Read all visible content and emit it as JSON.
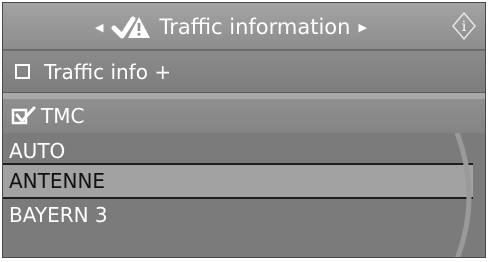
{
  "header": {
    "title": "Traffic information",
    "left_arrow_icon": "triangle-left-icon",
    "right_arrow_icon": "triangle-right-icon",
    "title_icon": "traffic-warning-icon",
    "info_button_icon": "info-icon"
  },
  "menu": {
    "traffic_info_label": "Traffic info +",
    "traffic_info_checked": false,
    "tmc_label": "TMC",
    "tmc_checked": true
  },
  "stations": [
    {
      "name": "AUTO",
      "selected": false
    },
    {
      "name": "ANTENNE",
      "selected": true
    },
    {
      "name": "BAYERN 3",
      "selected": false
    }
  ],
  "colors": {
    "panel_gray": "#7e7e7e",
    "selected_bg": "#a2a2a2",
    "text_light": "#ffffff",
    "text_dark": "#111111"
  }
}
